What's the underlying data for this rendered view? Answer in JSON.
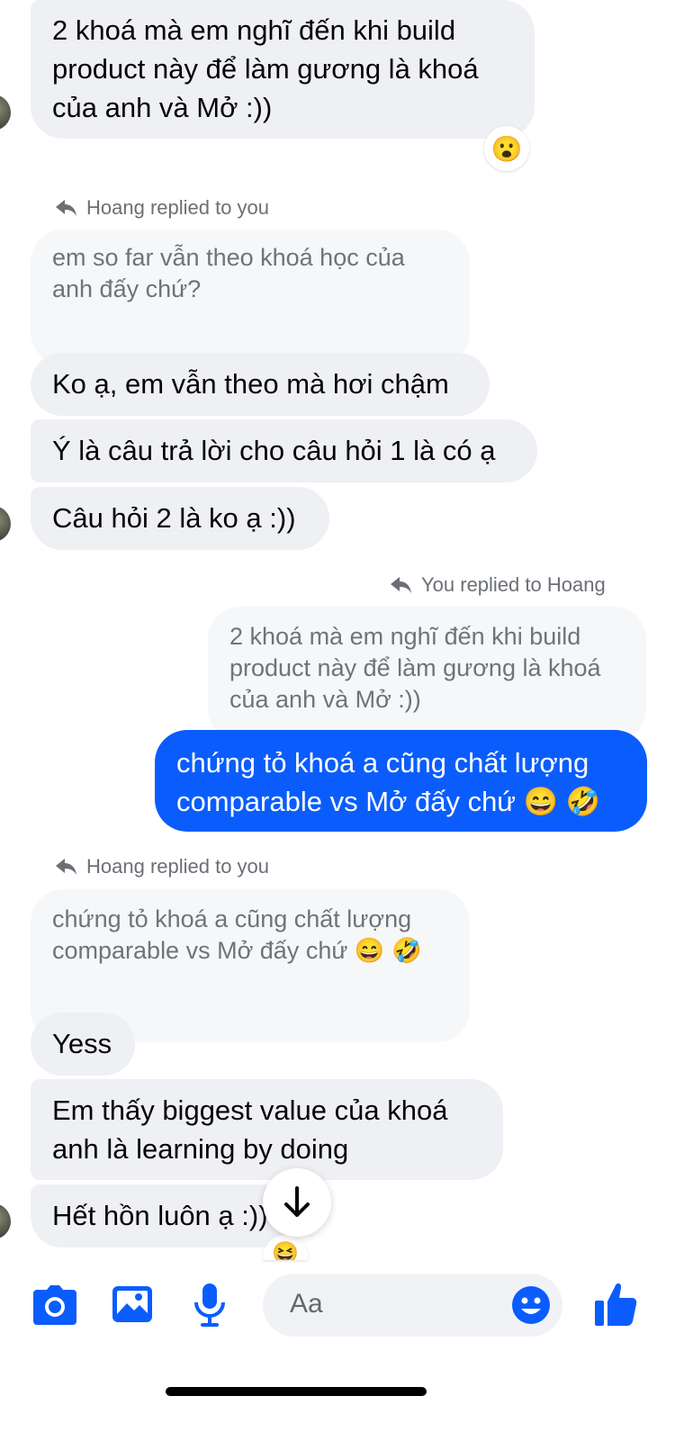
{
  "messages": {
    "m1": "2 khoá mà em nghĩ đến khi build product này để làm gương là khoá của anh và Mở :))",
    "m1_reaction": "😮",
    "reply1_label": "Hoang replied to you",
    "reply1_quote": "em so far vẫn theo khoá học của anh đấy chứ?",
    "m2": "Ko ạ, em vẫn theo mà hơi chậm",
    "m3": "Ý là câu trả lời cho câu hỏi 1 là có ạ",
    "m4": "Câu hỏi 2 là ko ạ :))",
    "reply2_label": "You replied to Hoang",
    "reply2_quote": "2 khoá mà em nghĩ đến khi build product này để làm gương là khoá của anh và Mở :))",
    "m5_outgoing": "chứng tỏ khoá a cũng chất lượng comparable vs Mở đấy chứ 😄 🤣",
    "reply3_label": "Hoang replied to you",
    "reply3_quote": "chứng tỏ khoá a cũng chất lượng comparable vs Mở đấy chứ 😄 🤣",
    "m6": "Yess",
    "m7": "Em thấy biggest value của khoá anh là learning by doing",
    "m8": "Hết hồn luôn ạ :))",
    "m8_reaction": "😆"
  },
  "composer": {
    "placeholder": "Aa"
  },
  "colors": {
    "accent": "#0a5dfc",
    "incoming_bubble": "#eff0f4",
    "quote_bubble": "#f6f7f9"
  },
  "icons": [
    "camera-icon",
    "image-icon",
    "microphone-icon",
    "emoji-icon",
    "thumbs-up-icon",
    "reply-arrow-icon",
    "arrow-down-icon"
  ]
}
